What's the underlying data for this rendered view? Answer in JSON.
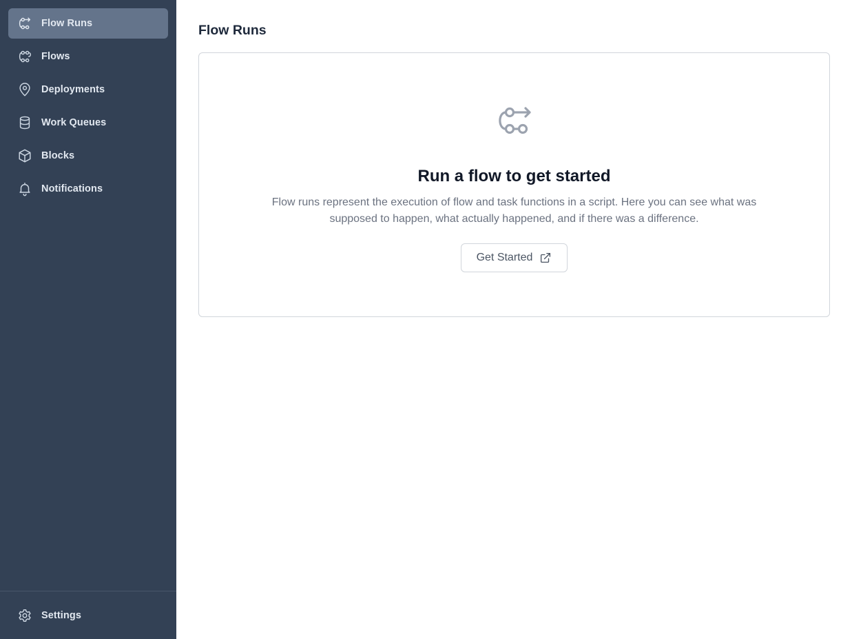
{
  "sidebar": {
    "items": [
      {
        "label": "Flow Runs",
        "icon": "flow-runs-icon",
        "active": true
      },
      {
        "label": "Flows",
        "icon": "flows-icon"
      },
      {
        "label": "Deployments",
        "icon": "map-pin-icon"
      },
      {
        "label": "Work Queues",
        "icon": "database-icon"
      },
      {
        "label": "Blocks",
        "icon": "cube-icon"
      },
      {
        "label": "Notifications",
        "icon": "bell-icon"
      }
    ],
    "settings": {
      "label": "Settings",
      "icon": "gear-icon"
    }
  },
  "main": {
    "title": "Flow Runs",
    "empty_state": {
      "icon": "flow-runs-icon",
      "heading": "Run a flow to get started",
      "description": "Flow runs represent the execution of flow and task functions in a script. Here you can see what was supposed to happen, what actually happened, and if there was a difference.",
      "button_label": "Get Started",
      "button_icon": "external-link-icon"
    }
  },
  "colors": {
    "sidebar_bg": "#334155",
    "sidebar_active": "#64748b",
    "sidebar_text": "#e2e8f0",
    "heading": "#111827",
    "muted": "#6b7280"
  }
}
